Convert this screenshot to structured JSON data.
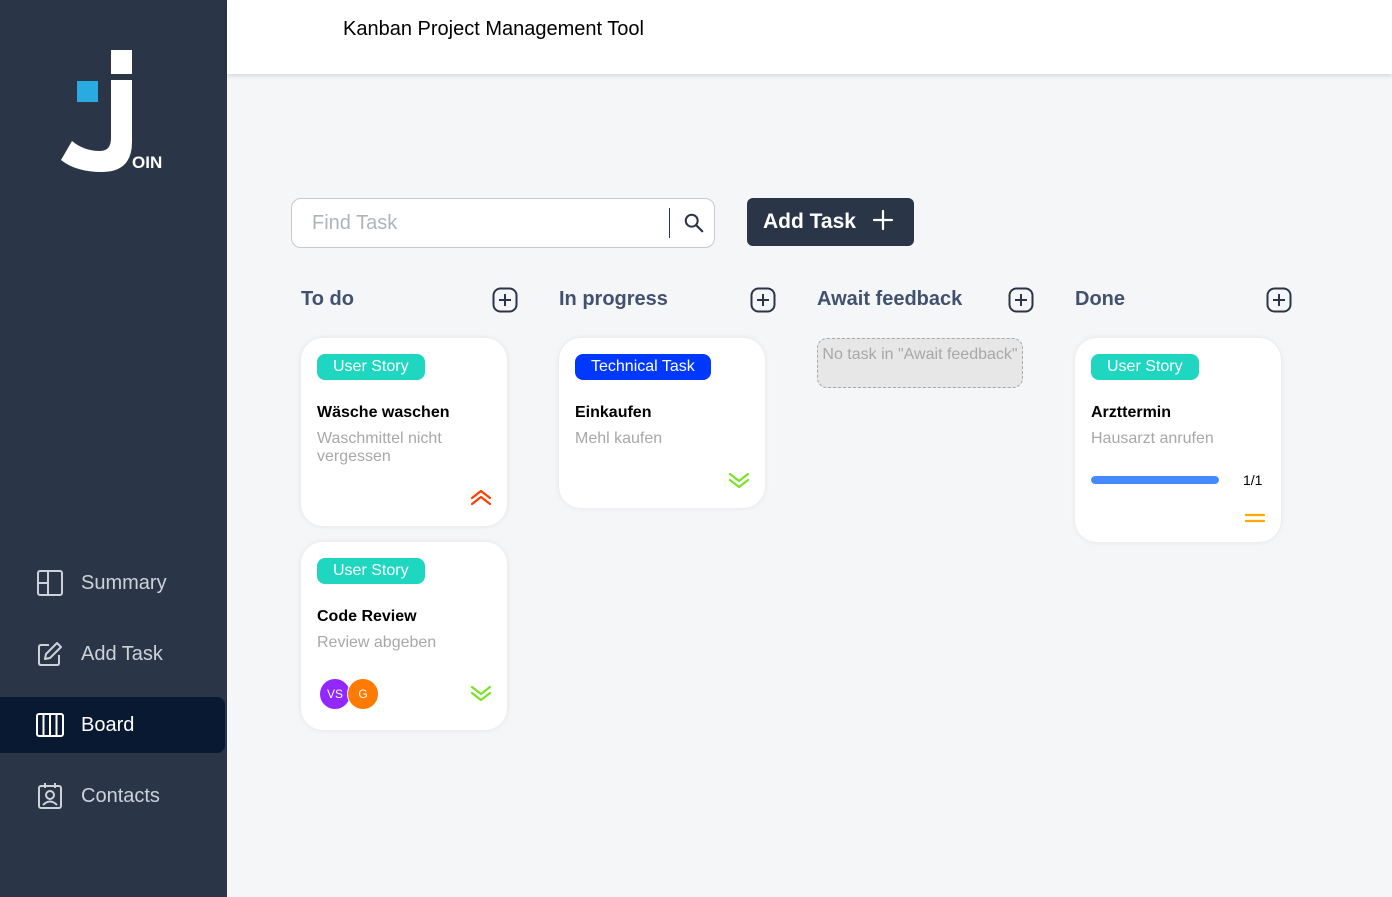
{
  "app": {
    "logo_text": "OIN"
  },
  "sidebar": {
    "items": [
      {
        "label": "Summary",
        "icon": "summary-icon"
      },
      {
        "label": "Add Task",
        "icon": "edit-icon"
      },
      {
        "label": "Board",
        "icon": "board-icon",
        "active": true
      },
      {
        "label": "Contacts",
        "icon": "contacts-icon"
      }
    ]
  },
  "header": {
    "title": "Kanban Project Management Tool"
  },
  "toolbar": {
    "search_placeholder": "Find Task",
    "search_value": "",
    "add_task_label": "Add Task"
  },
  "board": {
    "columns": [
      {
        "title": "To do",
        "cards": [
          {
            "tag": "User Story",
            "tag_color": "#1fd7c1",
            "title": "Wäsche waschen",
            "description": "Waschmittel nicht vergessen",
            "priority": "urgent",
            "priority_color": "#ff3d00"
          },
          {
            "tag": "User Story",
            "tag_color": "#1fd7c1",
            "title": "Code Review",
            "description": "Review abgeben",
            "priority": "low",
            "priority_color": "#7ae229",
            "assignees": [
              {
                "initials": "VS",
                "color": "#9327ff"
              },
              {
                "initials": "G",
                "color": "#ff7a00"
              }
            ]
          }
        ]
      },
      {
        "title": "In progress",
        "cards": [
          {
            "tag": "Technical Task",
            "tag_color": "#0038ff",
            "title": "Einkaufen",
            "description": "Mehl kaufen",
            "priority": "low",
            "priority_color": "#7ae229"
          }
        ]
      },
      {
        "title": "Await feedback",
        "empty_text": "No task in \"Await feedback\"",
        "cards": []
      },
      {
        "title": "Done",
        "cards": [
          {
            "tag": "User Story",
            "tag_color": "#1fd7c1",
            "title": "Arzttermin",
            "description": "Hausarzt anrufen",
            "priority": "medium",
            "priority_color": "#ffa800",
            "subtasks_progress": 1.0,
            "subtasks_text": "1/1"
          }
        ]
      }
    ]
  },
  "colors": {
    "sidebar_bg": "#2a3647",
    "active_nav_bg": "#091931",
    "progress": "#4589ff"
  }
}
